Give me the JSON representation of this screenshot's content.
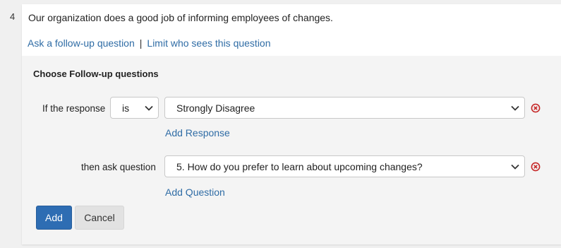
{
  "question": {
    "number": "4",
    "text": "Our organization does a good job of informing employees of changes.",
    "links": {
      "ask_follow_up": "Ask a follow-up question",
      "separator": "|",
      "limit_visibility": "Limit who sees this question"
    }
  },
  "follow_up": {
    "title": "Choose Follow-up questions",
    "condition": {
      "label": "If the response",
      "operator": "is",
      "response": "Strongly Disagree",
      "add_response_label": "Add Response"
    },
    "action": {
      "label": "then ask question",
      "question": "5. How do you prefer to learn about upcoming changes?",
      "add_question_label": "Add Question"
    },
    "buttons": {
      "add": "Add",
      "cancel": "Cancel"
    }
  },
  "colors": {
    "link": "#2f6ca5",
    "primary_button": "#2e6db3",
    "remove_icon": "#c62828",
    "panel_background": "#f4f4f4"
  },
  "icons": {
    "dropdown": "chevron-down-icon",
    "remove": "remove-circle-icon"
  }
}
